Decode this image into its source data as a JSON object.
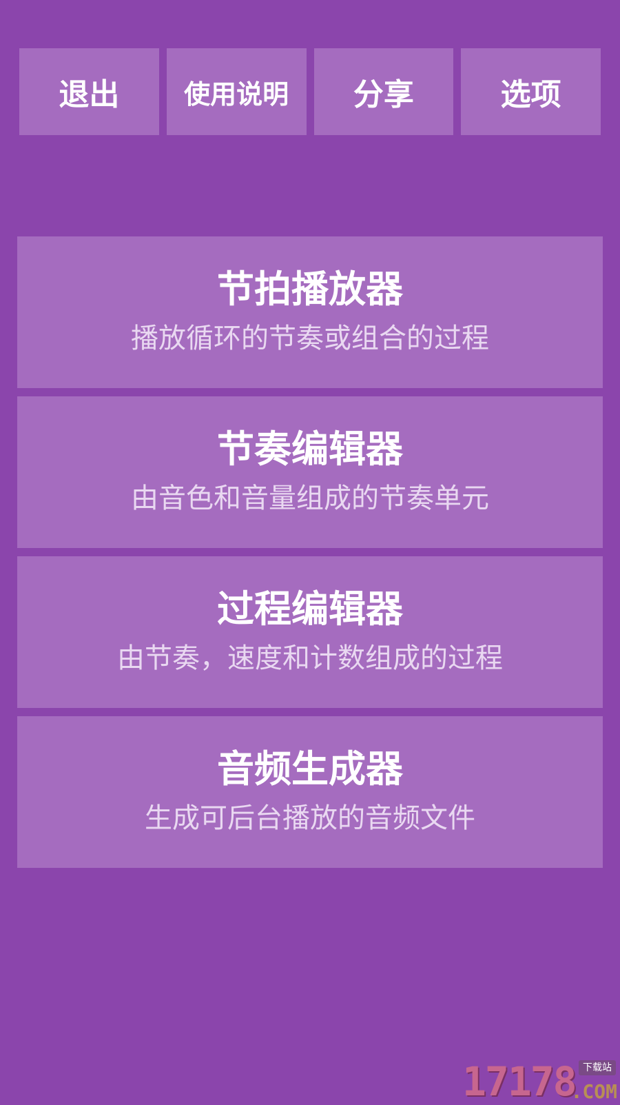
{
  "toolbar": {
    "buttons": [
      {
        "label": "退出"
      },
      {
        "label": "使用说明"
      },
      {
        "label": "分享"
      },
      {
        "label": "选项"
      }
    ]
  },
  "menu": {
    "items": [
      {
        "title": "节拍播放器",
        "subtitle": "播放循环的节奏或组合的过程"
      },
      {
        "title": "节奏编辑器",
        "subtitle": "由音色和音量组成的节奏单元"
      },
      {
        "title": "过程编辑器",
        "subtitle": "由节奏，速度和计数组成的过程"
      },
      {
        "title": "音频生成器",
        "subtitle": "生成可后台播放的音频文件"
      }
    ]
  },
  "watermark": {
    "digits": "17178",
    "tag": "下载站",
    "suffix": ".COM"
  },
  "colors": {
    "background": "#8b45ac",
    "card": "#a56cbf",
    "title_text": "#ffffff",
    "subtitle_text": "#e9d8f1"
  }
}
